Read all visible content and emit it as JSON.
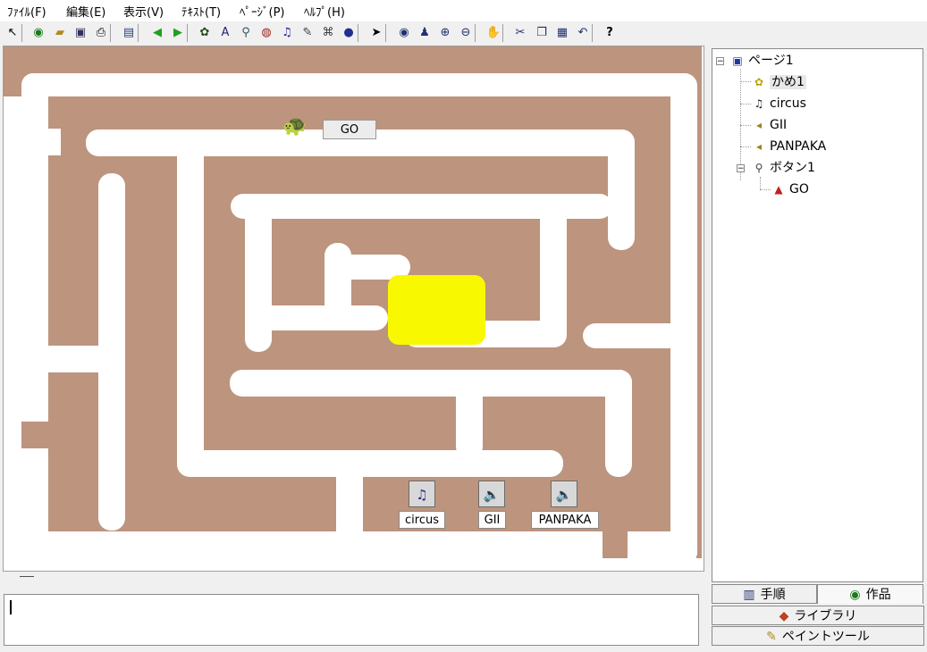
{
  "menu": {
    "file": "ﾌｧｲﾙ(F)",
    "edit": "編集(E)",
    "view": "表示(V)",
    "text": "ﾃｷｽﾄ(T)",
    "page": "ﾍﾟｰｼﾞ(P)",
    "help": "ﾍﾙﾌﾟ(H)"
  },
  "toolbar": {
    "icons": [
      "pointer-icon",
      "globe-icon",
      "open-folder-icon",
      "save-icon",
      "print-icon",
      "layout-icon",
      "back-arrow-icon",
      "forward-arrow-icon",
      "turtle-tool-icon",
      "text-tool-icon",
      "antenna-tool-icon",
      "eye-tool-icon",
      "music-tool-icon",
      "pen-tool-icon",
      "camera-tool-icon",
      "globe-blue-icon",
      "select-arrow-icon",
      "look-icon",
      "stamp-icon",
      "zoom-in-icon",
      "zoom-out-icon",
      "stop-icon",
      "cut-icon",
      "copy-icon",
      "paste-icon",
      "undo-icon",
      "help-icon"
    ],
    "help_glyph": "?"
  },
  "stage": {
    "go_button_label": "GO",
    "sounds": [
      {
        "icon": "music-file-icon",
        "label": "circus"
      },
      {
        "icon": "speaker-icon",
        "label": "GII"
      },
      {
        "icon": "speaker-icon",
        "label": "PANPAKA"
      }
    ],
    "colors": {
      "background": "#bd947d",
      "path": "#ffffff",
      "goal": "#f8f800"
    }
  },
  "tree": {
    "page": "ページ1",
    "turtle": "かめ1",
    "circus": "circus",
    "gii": "GII",
    "panpaka": "PANPAKA",
    "button": "ボタン1",
    "go": "GO"
  },
  "tabs": {
    "procedure": "手順",
    "work": "作品"
  },
  "panel_buttons": {
    "library": "ライブラリ",
    "paint": "ペイントツール"
  }
}
